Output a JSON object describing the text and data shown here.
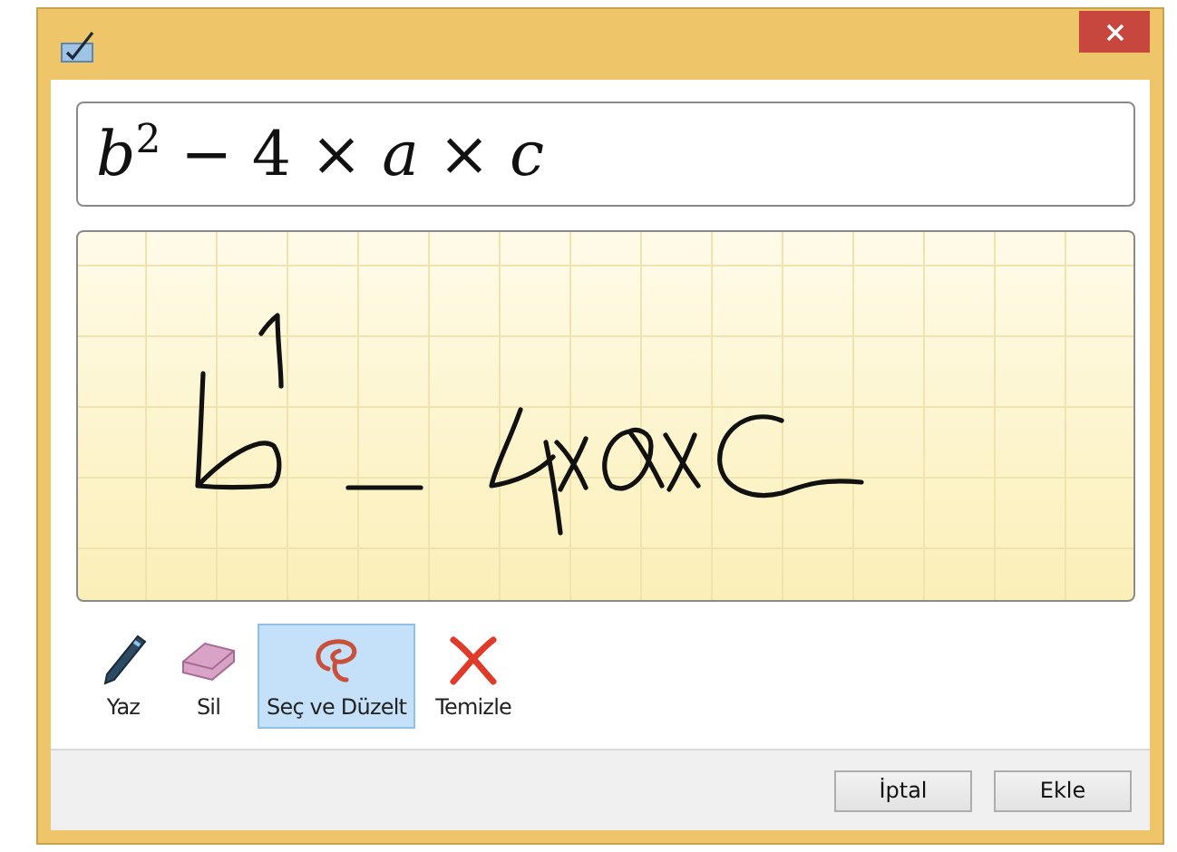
{
  "preview": {
    "formula": "*b*$^{2}$ − 4 × *a* × *c*"
  },
  "tools": [
    {
      "kind": "pen",
      "label": "Yaz",
      "selected": false
    },
    {
      "kind": "eraser",
      "label": "Sil",
      "selected": false
    },
    {
      "kind": "lasso",
      "label": "Seç ve Düzelt",
      "selected": true
    },
    {
      "kind": "clear",
      "label": "Temizle",
      "selected": false
    }
  ],
  "buttons": [
    "İptal",
    "Ekle"
  ]
}
